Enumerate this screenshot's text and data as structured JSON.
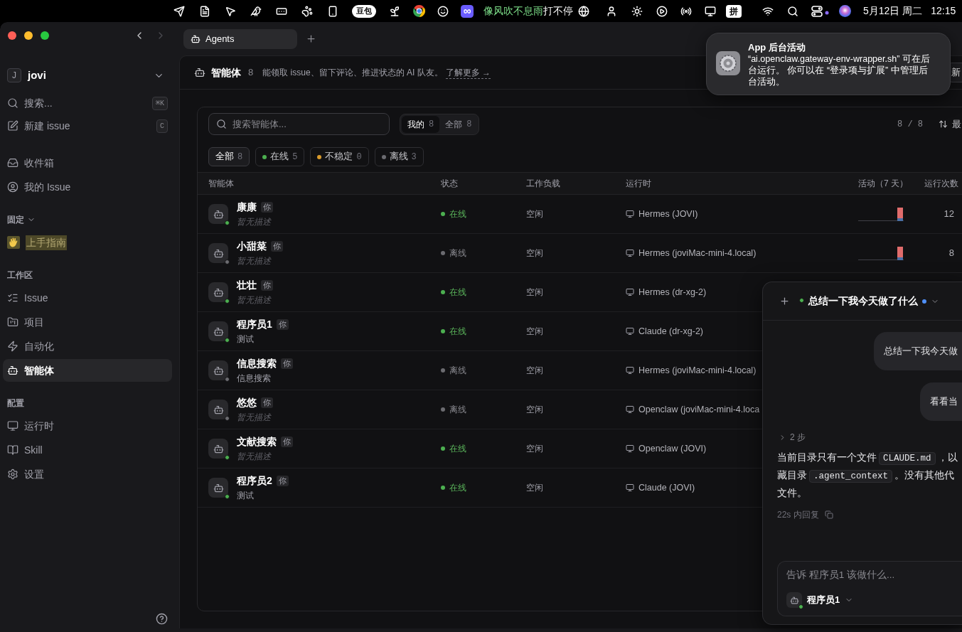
{
  "menu_bar": {
    "app_badge": "豆包",
    "lyrics_sung": "像风吹不息雨",
    "lyrics_rest": "打不停",
    "input_method": "拼",
    "date": "5月12日 周二",
    "time": "12:15"
  },
  "window_nav": {
    "back_disabled": false,
    "forward_disabled": true
  },
  "sidebar": {
    "workspace": {
      "initial": "J",
      "name": "jovi"
    },
    "actions": [
      {
        "kind": "search",
        "label": "搜索...",
        "shortcut": "⌘K"
      },
      {
        "kind": "new",
        "label": "新建 issue",
        "shortcut": "C"
      }
    ],
    "sections": [
      {
        "items": [
          {
            "kind": "inbox",
            "label": "收件箱",
            "selected": false,
            "highlighted": false
          },
          {
            "kind": "user",
            "label": "我的 Issue",
            "selected": false,
            "highlighted": false
          }
        ]
      },
      {
        "title": "固定",
        "expanded": true,
        "items": [
          {
            "kind": "wave",
            "label": "上手指南",
            "selected": false,
            "highlighted": true
          }
        ]
      },
      {
        "title": "工作区",
        "items": [
          {
            "kind": "issue",
            "label": "Issue",
            "selected": false,
            "highlighted": false
          },
          {
            "kind": "project",
            "label": "项目",
            "selected": false,
            "highlighted": false
          },
          {
            "kind": "automation",
            "label": "自动化",
            "selected": false,
            "highlighted": false
          },
          {
            "kind": "agent",
            "label": "智能体",
            "selected": true,
            "highlighted": false
          }
        ]
      },
      {
        "title": "配置",
        "items": [
          {
            "kind": "runtime",
            "label": "运行时",
            "selected": false,
            "highlighted": false
          },
          {
            "kind": "skill",
            "label": "Skill",
            "selected": false,
            "highlighted": false
          },
          {
            "kind": "settings",
            "label": "设置",
            "selected": false,
            "highlighted": false
          }
        ]
      }
    ]
  },
  "tabs": [
    {
      "label": "Agents",
      "selected": true
    }
  ],
  "header": {
    "title": "智能体",
    "count": "8",
    "description": "能领取 issue、留下评论、推进状态的 AI 队友。",
    "link": "了解更多 →",
    "button": "新"
  },
  "toolbar": {
    "search_placeholder": "搜索智能体...",
    "scopes": [
      {
        "label": "我的",
        "count": "8",
        "selected": true
      },
      {
        "label": "全部",
        "count": "8",
        "selected": false
      }
    ],
    "result_count": "8 / 8",
    "sort_label": "最"
  },
  "filters": [
    {
      "label": "全部",
      "count": "8",
      "selected": true
    },
    {
      "label": "在线",
      "count": "5",
      "selected": false,
      "color": "#4caf50"
    },
    {
      "label": "不稳定",
      "count": "0",
      "selected": false,
      "color": "#d99a2b"
    },
    {
      "label": "离线",
      "count": "3",
      "selected": false,
      "color": "#6b6b70"
    }
  ],
  "table": {
    "columns": [
      "智能体",
      "状态",
      "工作负载",
      "运行时",
      "活动（7 天）",
      "运行次数"
    ],
    "rows": [
      {
        "name": "康康",
        "badge": "你",
        "description": "暂无描述",
        "description_placeholder": true,
        "online": true,
        "status_label": "在线",
        "workload": "空闲",
        "runtime": "Hermes (JOVI)",
        "runs": "12"
      },
      {
        "name": "小甜菜",
        "badge": "你",
        "description": "暂无描述",
        "description_placeholder": true,
        "online": false,
        "status_label": "离线",
        "workload": "空闲",
        "runtime": "Hermes (joviMac-mini-4.local)",
        "runs": "8"
      },
      {
        "name": "壮壮",
        "badge": "你",
        "description": "暂无描述",
        "description_placeholder": true,
        "online": true,
        "status_label": "在线",
        "workload": "空闲",
        "runtime": "Hermes (dr-xg-2)"
      },
      {
        "name": "程序员1",
        "badge": "你",
        "description": "测试",
        "description_placeholder": false,
        "online": true,
        "status_label": "在线",
        "workload": "空闲",
        "runtime": "Claude (dr-xg-2)"
      },
      {
        "name": "信息搜索",
        "badge": "你",
        "description": "信息搜索",
        "description_placeholder": false,
        "online": false,
        "status_label": "离线",
        "workload": "空闲",
        "runtime": "Hermes (joviMac-mini-4.local)"
      },
      {
        "name": "悠悠",
        "badge": "你",
        "description": "暂无描述",
        "description_placeholder": true,
        "online": false,
        "status_label": "离线",
        "workload": "空闲",
        "runtime": "Openclaw (joviMac-mini-4.loca"
      },
      {
        "name": "文献搜索",
        "badge": "你",
        "description": "暂无描述",
        "description_placeholder": true,
        "online": true,
        "status_label": "在线",
        "workload": "空闲",
        "runtime": "Openclaw (JOVI)"
      },
      {
        "name": "程序员2",
        "badge": "你",
        "description": "测试",
        "description_placeholder": false,
        "online": true,
        "status_label": "在线",
        "workload": "空闲",
        "runtime": "Claude (JOVI)"
      }
    ]
  },
  "chat": {
    "title": "总结一下我今天做了什么",
    "agent_online": true,
    "unread": true,
    "messages": [
      {
        "kind": "user",
        "text": "总结一下我今天做"
      },
      {
        "kind": "user",
        "text": "看看当"
      },
      {
        "kind": "steps",
        "text": "2 步",
        "expanded": false
      },
      {
        "kind": "assistant",
        "lines": [
          [
            {
              "kind": "text",
              "text": "当前目录只有一个文件"
            },
            {
              "kind": "code",
              "text": "CLAUDE.md"
            },
            {
              "kind": "text",
              "text": "，以"
            }
          ],
          [
            {
              "kind": "text",
              "text": "藏目录"
            },
            {
              "kind": "code",
              "text": ".agent_context"
            },
            {
              "kind": "text",
              "text": "。没有其他代"
            }
          ],
          [
            {
              "kind": "text",
              "text": "文件。"
            }
          ]
        ]
      },
      {
        "kind": "meta",
        "text": "22s 内回复"
      }
    ],
    "composer": {
      "placeholder": "告诉 程序员1 该做什么...",
      "agent": "程序员1",
      "agent_online": true
    }
  },
  "notification": {
    "title": "App 后台活动",
    "body": "“ai.openclaw.gateway-env-wrapper.sh” 可在后台运行。 你可以在 “登录项与扩展” 中管理后台活动。"
  }
}
